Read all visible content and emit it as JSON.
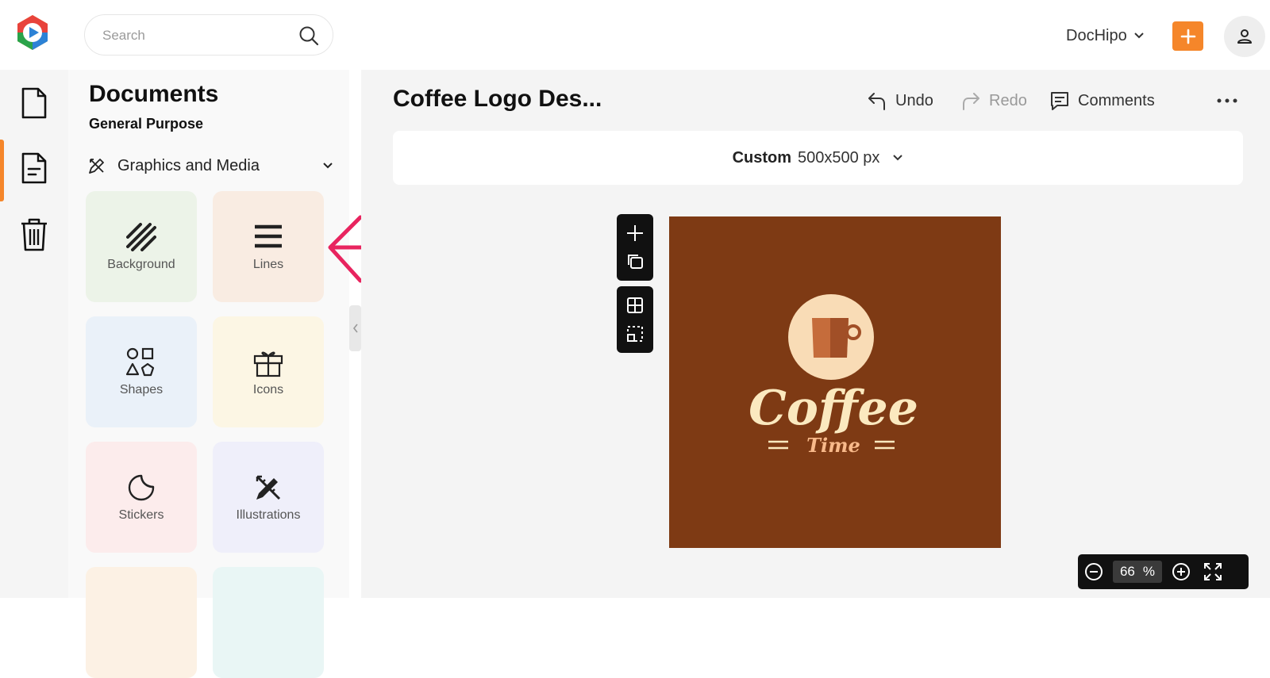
{
  "app": {
    "logo": "dochipo-logo",
    "brand_color": "#f5862a"
  },
  "header": {
    "search_placeholder": "Search",
    "workspace_label": "DocHipo",
    "add_button": "plus-icon",
    "profile_button": "user-icon"
  },
  "rail": {
    "items": [
      {
        "icon": "file-icon",
        "active": false
      },
      {
        "icon": "document-icon",
        "active": true
      },
      {
        "icon": "trash-icon",
        "active": false
      }
    ]
  },
  "panel": {
    "title": "Documents",
    "subtitle": "General Purpose",
    "category": "Graphics and Media",
    "tiles": [
      {
        "label": "Background",
        "icon": "stripes-icon",
        "bg": "#ecf3e8"
      },
      {
        "label": "Lines",
        "icon": "lines-icon",
        "bg": "#f9ece2"
      },
      {
        "label": "Shapes",
        "icon": "shapes-icon",
        "bg": "#eaf1f9"
      },
      {
        "label": "Icons",
        "icon": "gift-icon",
        "bg": "#fcf6e4"
      },
      {
        "label": "Stickers",
        "icon": "sticker-icon",
        "bg": "#fcecec"
      },
      {
        "label": "Illustrations",
        "icon": "pen-ruler-icon",
        "bg": "#efeffa"
      },
      {
        "label": "",
        "icon": "",
        "bg": "#fcf1e4"
      },
      {
        "label": "",
        "icon": "",
        "bg": "#e9f6f5"
      }
    ]
  },
  "editor": {
    "doc_title": "Coffee Logo Des...",
    "undo_label": "Undo",
    "redo_label": "Redo",
    "comments_label": "Comments",
    "size_kind": "Custom",
    "size_value": "500x500 px",
    "canvas": {
      "background": "#7e3a14",
      "logo_word": "Coffee",
      "logo_sub": "Time"
    },
    "zoom": {
      "value": "66",
      "unit": "%"
    }
  }
}
